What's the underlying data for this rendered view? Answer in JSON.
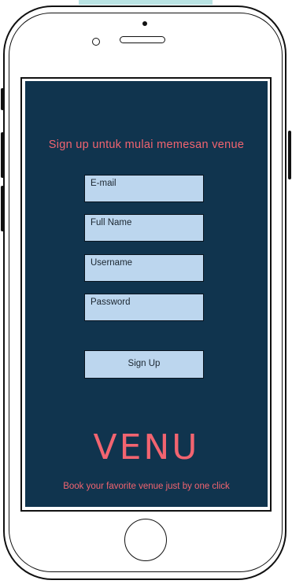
{
  "screen": {
    "heading": "Sign up untuk mulai memesan venue",
    "fields": [
      {
        "label": "E-mail"
      },
      {
        "label": "Full Name"
      },
      {
        "label": "Username"
      },
      {
        "label": "Password"
      }
    ],
    "signup_label": "Sign Up",
    "logo": "VENU",
    "tagline": "Book your favorite venue just by one click"
  },
  "colors": {
    "screen_bg": "#10344e",
    "accent": "#f26470",
    "field_bg": "#bcd6ee"
  },
  "icons": [
    "camera-icon",
    "sensor-icon",
    "speaker-icon",
    "home-button-icon"
  ]
}
